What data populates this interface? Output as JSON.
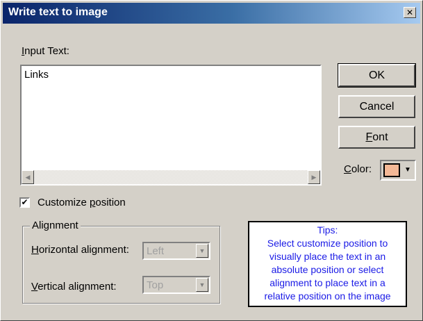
{
  "window": {
    "title": "Write text to image",
    "close_glyph": "✕"
  },
  "input": {
    "label_accel": "I",
    "label_rest": "nput Text:",
    "value": "Links",
    "scroll_left_glyph": "◀",
    "scroll_right_glyph": "▶"
  },
  "buttons": {
    "ok": "OK",
    "cancel": "Cancel",
    "font_accel": "F",
    "font_rest": "ont"
  },
  "color": {
    "label_accel": "C",
    "label_rest": "olor:",
    "value": "#f4b896",
    "arrow_glyph": "▼"
  },
  "customize": {
    "checked": true,
    "check_glyph": "✔",
    "label_pre": "Customize ",
    "label_accel": "p",
    "label_post": "osition"
  },
  "alignment": {
    "group_label": "Alignment",
    "horizontal_label_accel": "H",
    "horizontal_label_rest": "orizontal alignment:",
    "horizontal_value": "Left",
    "vertical_label_accel": "V",
    "vertical_label_rest": "ertical alignment:",
    "vertical_value": "Top",
    "arrow_glyph": "▼"
  },
  "tips": {
    "lines": [
      "Tips:",
      "Select customize position to",
      "visually place the text in an",
      "absolute position or select",
      "alignment to place text in a",
      "relative position on the image"
    ]
  }
}
